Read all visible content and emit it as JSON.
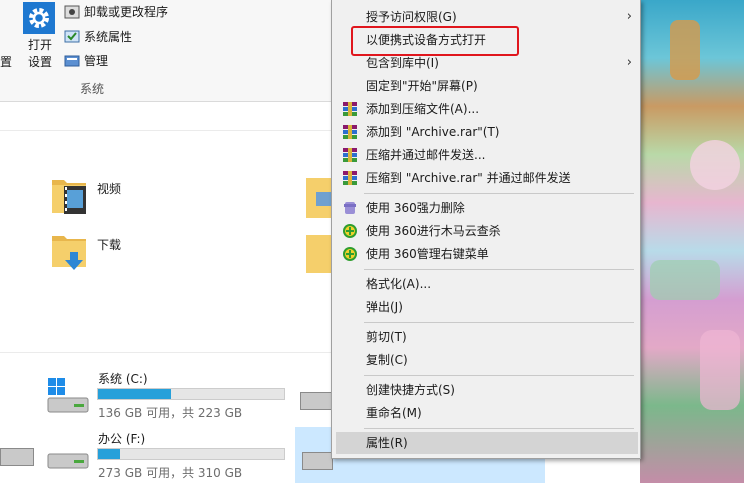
{
  "ribbon": {
    "open_label_line1": "打开",
    "open_label_line2": "设置",
    "cut_char": "置",
    "side_items": [
      {
        "label": "卸载或更改程序",
        "icon": "uninstall-icon"
      },
      {
        "label": "系统属性",
        "icon": "system-properties-icon"
      },
      {
        "label": "管理",
        "icon": "manage-icon"
      }
    ],
    "group_label": "系统"
  },
  "folders": [
    {
      "label": "视频",
      "icon": "video-folder-icon"
    },
    {
      "label": "下载",
      "icon": "download-folder-icon"
    }
  ],
  "drives": [
    {
      "name": "系统 (C:)",
      "free": "136 GB 可用，共 223 GB",
      "used_fraction": 0.39
    },
    {
      "name": "办公 (F:)",
      "free": "273 GB 可用，共 310 GB",
      "used_fraction": 0.12
    }
  ],
  "context_menu": {
    "items": [
      {
        "label": "授予访问权限(G)",
        "submenu": true
      },
      {
        "label": "以便携式设备方式打开",
        "highlighted_box": true
      },
      {
        "label": "包含到库中(I)",
        "submenu": true
      },
      {
        "label": "固定到\"开始\"屏幕(P)"
      },
      {
        "label": "添加到压缩文件(A)...",
        "icon": "winrar-icon"
      },
      {
        "label": "添加到 \"Archive.rar\"(T)",
        "icon": "winrar-icon"
      },
      {
        "label": "压缩并通过邮件发送...",
        "icon": "winrar-icon"
      },
      {
        "label": "压缩到 \"Archive.rar\" 并通过邮件发送",
        "icon": "winrar-icon"
      },
      {
        "label": "使用 360强力删除",
        "icon": "360-delete-icon"
      },
      {
        "label": "使用 360进行木马云查杀",
        "icon": "360-scan-icon"
      },
      {
        "label": "使用 360管理右键菜单",
        "icon": "360-menu-icon"
      },
      {
        "label": "格式化(A)..."
      },
      {
        "label": "弹出(J)"
      },
      {
        "label": "剪切(T)"
      },
      {
        "label": "复制(C)"
      },
      {
        "label": "创建快捷方式(S)"
      },
      {
        "label": "重命名(M)"
      },
      {
        "label": "属性(R)",
        "hovered": true
      }
    ],
    "submenu_arrow": "›"
  },
  "colors": {
    "accent": "#26a0da",
    "selection": "#cce8ff",
    "annotation_red": "#e0161d"
  }
}
